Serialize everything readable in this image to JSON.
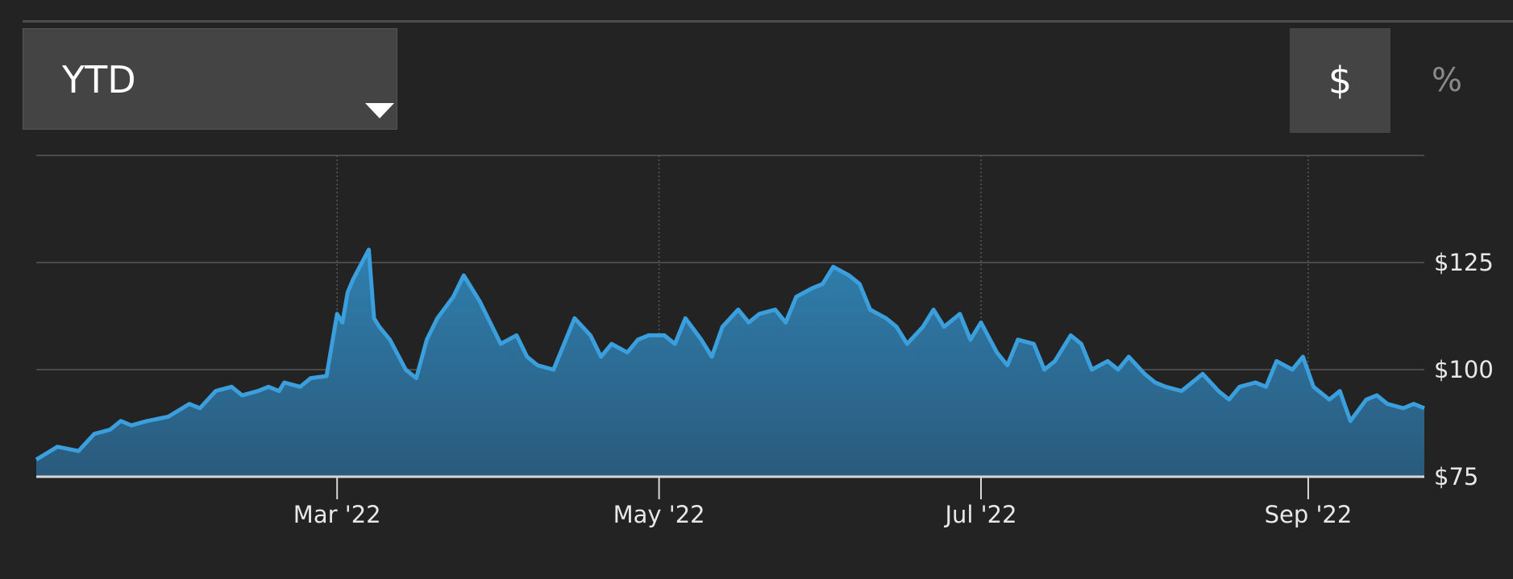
{
  "controls": {
    "range_label": "YTD",
    "dollar_label": "$",
    "percent_label": "%"
  },
  "colors": {
    "background": "#232323",
    "line": "#3a9fdc",
    "area_top": "#2f7fae",
    "area_bottom": "#2a5a7c",
    "grid": "#4a4a4a",
    "axis": "#d8d8d8"
  },
  "chart_data": {
    "type": "area",
    "title": "",
    "xlabel": "",
    "ylabel": "",
    "xlim": [
      "2022-01-03",
      "2022-09-23"
    ],
    "ylim": [
      75,
      150
    ],
    "y_ticks": [
      {
        "value": 75,
        "label": "$75"
      },
      {
        "value": 100,
        "label": "$100"
      },
      {
        "value": 125,
        "label": "$125"
      }
    ],
    "x_ticks": [
      {
        "date": "2022-03-01",
        "label": "Mar '22"
      },
      {
        "date": "2022-05-01",
        "label": "May '22"
      },
      {
        "date": "2022-07-01",
        "label": "Jul '22"
      },
      {
        "date": "2022-09-01",
        "label": "Sep '22"
      }
    ],
    "grid": true,
    "series": [
      {
        "x": [
          "2022-01-03",
          "2022-01-07",
          "2022-01-11",
          "2022-01-14",
          "2022-01-17",
          "2022-01-19",
          "2022-01-21",
          "2022-01-24",
          "2022-01-28",
          "2022-02-01",
          "2022-02-03",
          "2022-02-06",
          "2022-02-09",
          "2022-02-11",
          "2022-02-14",
          "2022-02-16",
          "2022-02-18",
          "2022-02-19",
          "2022-02-22",
          "2022-02-24",
          "2022-02-27",
          "2022-03-01",
          "2022-03-02",
          "2022-03-03",
          "2022-03-04",
          "2022-03-07",
          "2022-03-08",
          "2022-03-09",
          "2022-03-11",
          "2022-03-14",
          "2022-03-16",
          "2022-03-18",
          "2022-03-20",
          "2022-03-23",
          "2022-03-25",
          "2022-03-28",
          "2022-03-30",
          "2022-04-01",
          "2022-04-04",
          "2022-04-06",
          "2022-04-08",
          "2022-04-11",
          "2022-04-13",
          "2022-04-15",
          "2022-04-18",
          "2022-04-20",
          "2022-04-22",
          "2022-04-25",
          "2022-04-27",
          "2022-04-29",
          "2022-05-02",
          "2022-05-04",
          "2022-05-06",
          "2022-05-09",
          "2022-05-11",
          "2022-05-13",
          "2022-05-16",
          "2022-05-18",
          "2022-05-20",
          "2022-05-23",
          "2022-05-25",
          "2022-05-27",
          "2022-05-30",
          "2022-06-01",
          "2022-06-03",
          "2022-06-06",
          "2022-06-08",
          "2022-06-10",
          "2022-06-13",
          "2022-06-15",
          "2022-06-17",
          "2022-06-20",
          "2022-06-22",
          "2022-06-24",
          "2022-06-27",
          "2022-06-29",
          "2022-07-01",
          "2022-07-04",
          "2022-07-06",
          "2022-07-08",
          "2022-07-11",
          "2022-07-13",
          "2022-07-15",
          "2022-07-18",
          "2022-07-20",
          "2022-07-22",
          "2022-07-25",
          "2022-07-27",
          "2022-07-29",
          "2022-08-01",
          "2022-08-03",
          "2022-08-05",
          "2022-08-08",
          "2022-08-10",
          "2022-08-12",
          "2022-08-15",
          "2022-08-17",
          "2022-08-19",
          "2022-08-22",
          "2022-08-24",
          "2022-08-26",
          "2022-08-29",
          "2022-08-31",
          "2022-09-02",
          "2022-09-05",
          "2022-09-07",
          "2022-09-09",
          "2022-09-12",
          "2022-09-14",
          "2022-09-16",
          "2022-09-19",
          "2022-09-21",
          "2022-09-23"
        ],
        "y": [
          79,
          82,
          81,
          85,
          86,
          88,
          87,
          88,
          89,
          92,
          91,
          95,
          96,
          94,
          95,
          96,
          95,
          97,
          96,
          98,
          98.5,
          113,
          111,
          118,
          121,
          128,
          112,
          110,
          107,
          100,
          98,
          107,
          112,
          117,
          122,
          116,
          111,
          106,
          108,
          103,
          101,
          100,
          106,
          112,
          108,
          103,
          106,
          104,
          107,
          108,
          108,
          106,
          112,
          107,
          103,
          110,
          114,
          111,
          113,
          114,
          111,
          117,
          119,
          120,
          124,
          122,
          120,
          114,
          112,
          110,
          106,
          110,
          114,
          110,
          113,
          107,
          111,
          104,
          101,
          107,
          106,
          100,
          102,
          108,
          106,
          100,
          102,
          100,
          103,
          99,
          97,
          96,
          95,
          97,
          99,
          95,
          93,
          96,
          97,
          96,
          102,
          100,
          103,
          96,
          93,
          95,
          88,
          93,
          94,
          92,
          91,
          92,
          91
        ],
        "note": ""
      }
    ]
  }
}
